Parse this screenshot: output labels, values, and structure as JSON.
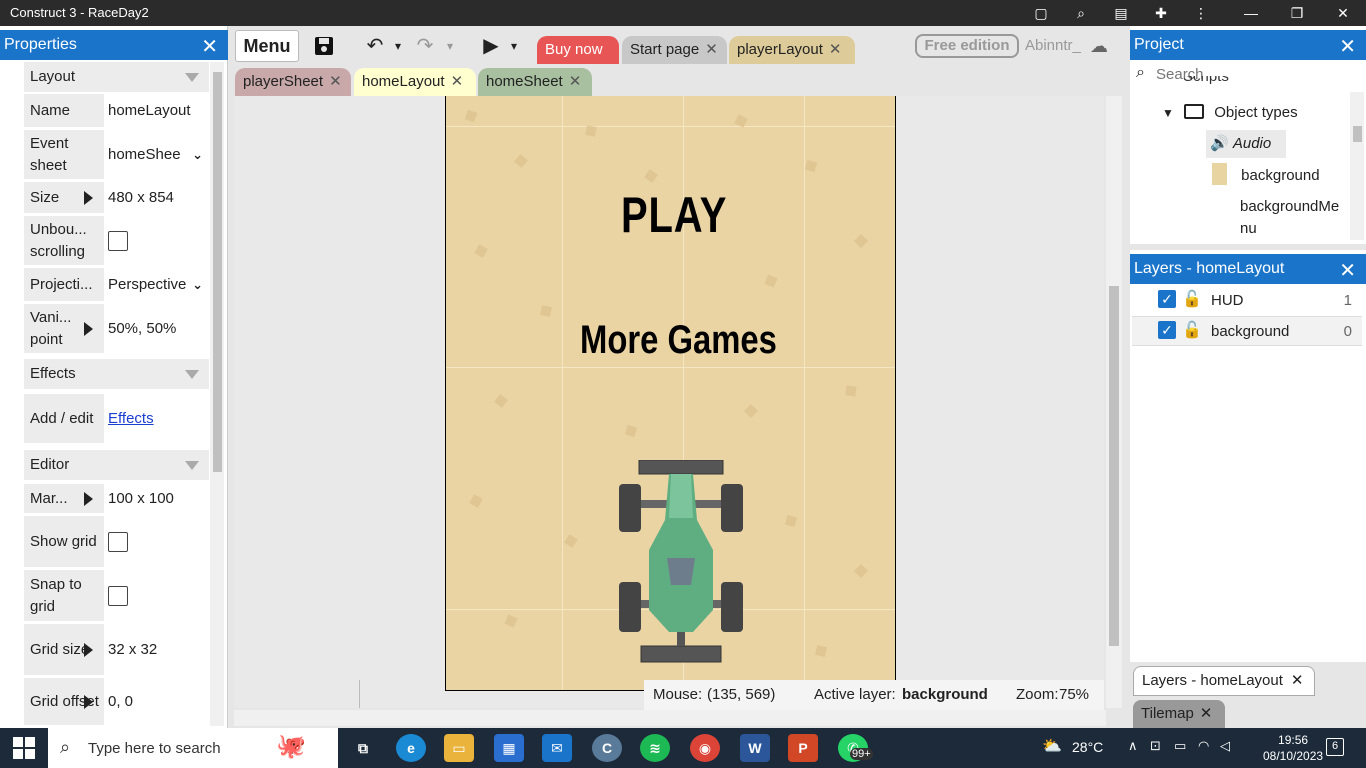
{
  "window": {
    "title": "Construct 3 - RaceDay2"
  },
  "properties": {
    "title": "Properties",
    "sections": {
      "layout": "Layout",
      "effects": "Effects",
      "editor": "Editor"
    },
    "rows": {
      "name": {
        "label": "Name",
        "value": "homeLayout"
      },
      "event_sheet": {
        "label": "Event sheet",
        "value": "homeShee"
      },
      "size": {
        "label": "Size",
        "value": "480 x 854"
      },
      "unbounded": {
        "label": "Unbou... scrolling",
        "checked": false
      },
      "projection": {
        "label": "Projecti...",
        "value": "Perspective"
      },
      "vanishing": {
        "label": "Vani... point",
        "value": "50%, 50%"
      },
      "add_edit": {
        "label": "Add / edit",
        "link": "Effects"
      },
      "margins": {
        "label": "Mar...",
        "value": "100 x 100"
      },
      "show_grid": {
        "label": "Show grid",
        "checked": false
      },
      "snap_grid": {
        "label": "Snap to grid",
        "checked": false
      },
      "grid_size": {
        "label": "Grid size",
        "value": "32 x 32"
      },
      "grid_offset": {
        "label": "Grid offset",
        "value": "0, 0"
      }
    }
  },
  "toolbar": {
    "menu_label": "Menu",
    "buy_now": "Buy now",
    "start_page": "Start page",
    "player_layout": "playerLayout",
    "free_edition": "Free edition",
    "user": "Abinntr_"
  },
  "editor_tabs": {
    "player_sheet": "playerSheet",
    "home_layout": "homeLayout",
    "home_sheet": "homeSheet"
  },
  "layout_canvas": {
    "play_text": "PLAY",
    "more_games_text": "More Games"
  },
  "status_bar": {
    "mouse_label": "Mouse:",
    "mouse_value": "(135, 569)",
    "active_layer_label": "Active layer:",
    "active_layer_value": "background",
    "zoom_label": "Zoom:",
    "zoom_value": "75%"
  },
  "project": {
    "title": "Project",
    "search_placeholder": "Search",
    "tree": {
      "scripts": "Scripts",
      "object_types": "Object types",
      "audio": "Audio",
      "background": "background",
      "background_menu": "backgroundMenu"
    }
  },
  "layers": {
    "title": "Layers - homeLayout",
    "items": [
      {
        "name": "HUD",
        "index": "1"
      },
      {
        "name": "background",
        "index": "0"
      }
    ]
  },
  "bottom_tabs": {
    "layers": "Layers - homeLayout",
    "tilemap": "Tilemap"
  },
  "taskbar": {
    "search_placeholder": "Type here to search",
    "temperature": "28°C",
    "time": "19:56",
    "date": "08/10/2023",
    "whatsapp_badge": "99+",
    "notif_count": "6"
  },
  "colors": {
    "accent": "#1a74c9",
    "layout_bg": "#ebd4a4",
    "buy_tab": "#e85555"
  }
}
